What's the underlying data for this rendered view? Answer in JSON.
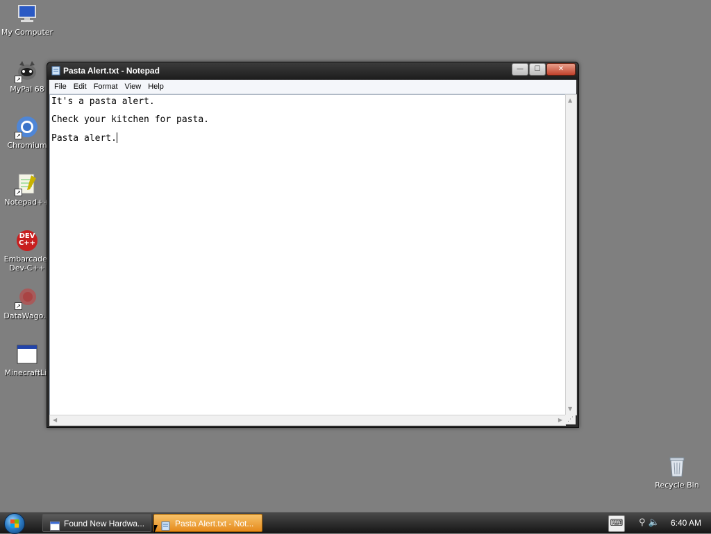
{
  "desktop": {
    "icons": [
      {
        "label": "My Computer",
        "icon": "computer-icon"
      },
      {
        "label": "MyPal 68",
        "icon": "mypal-icon"
      },
      {
        "label": "Chromium",
        "icon": "chromium-icon"
      },
      {
        "label": "Notepad++",
        "icon": "notepadpp-icon"
      },
      {
        "label": "Embarcadero Dev-C++",
        "line1": "Embarcader",
        "line2": "Dev-C++",
        "icon": "devcpp-icon",
        "badge": "DEV\nC++"
      },
      {
        "label": "DataWago...",
        "icon": "datawagon-icon"
      },
      {
        "label": "MinecraftLit",
        "icon": "minecraft-icon"
      },
      {
        "label": "Recycle Bin",
        "icon": "recycle-bin-icon"
      }
    ]
  },
  "window": {
    "title": "Pasta Alert.txt - Notepad",
    "controls": {
      "minimize": "—",
      "maximize": "☐",
      "close": "✕"
    },
    "menu": [
      "File",
      "Edit",
      "Format",
      "View",
      "Help"
    ],
    "content_lines": [
      "It's a pasta alert.",
      "Check your kitchen for pasta.",
      "Pasta alert."
    ]
  },
  "taskbar": {
    "tasks": [
      {
        "label": "Found New Hardwa...",
        "active": false
      },
      {
        "label": "Pasta Alert.txt - Not...",
        "active": true
      }
    ],
    "clock": "6:40 AM",
    "keyboard_icon": "⌨"
  },
  "colors": {
    "desktop_bg": "#7f7f7f",
    "active_task": "#f0a93a"
  }
}
